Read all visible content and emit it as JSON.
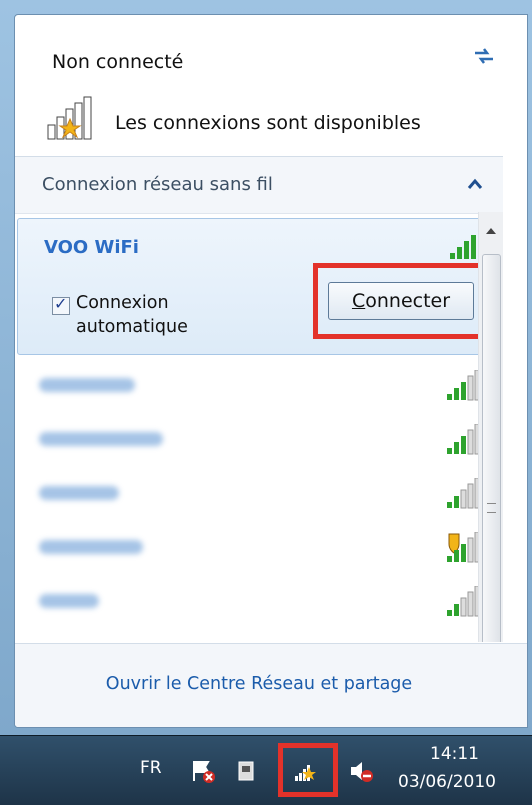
{
  "status": {
    "title": "Non connecté",
    "availability": "Les connexions sont disponibles"
  },
  "section": {
    "label": "Connexion réseau sans fil"
  },
  "selected_network": {
    "name": "VOO WiFi",
    "auto_connect_label_line1": "Connexion",
    "auto_connect_label_line2": "automatique",
    "auto_connect_checked": true,
    "connect_button": "Connecter"
  },
  "other_networks": [
    {
      "name_visible": false,
      "secured": false
    },
    {
      "name_visible": false,
      "secured": false
    },
    {
      "name_visible": false,
      "secured": false
    },
    {
      "name_visible": false,
      "secured": true
    },
    {
      "name_visible": false,
      "secured": false
    }
  ],
  "footer": {
    "link": "Ouvrir le Centre Réseau et partage"
  },
  "taskbar": {
    "language": "FR",
    "time": "14:11",
    "date": "03/06/2010"
  },
  "colors": {
    "highlight": "#e3322a",
    "link": "#1b5cab",
    "selected_name": "#2b6cc4",
    "signal": "#2ea32e"
  }
}
